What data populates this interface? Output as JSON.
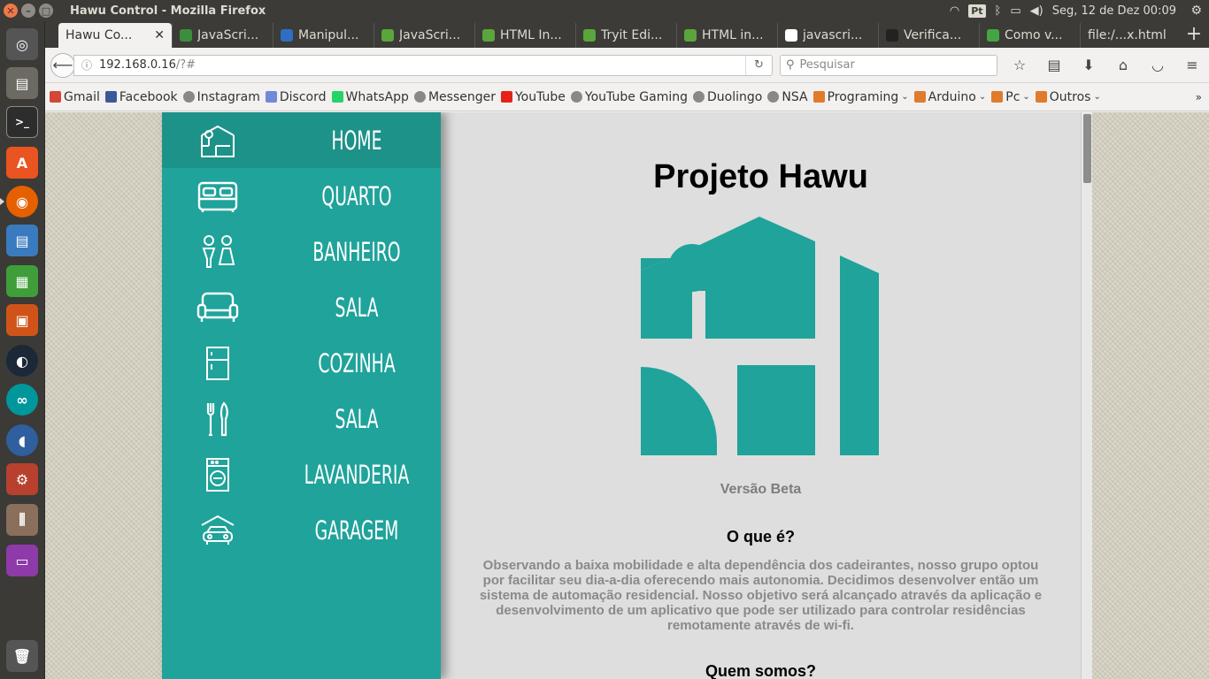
{
  "system_panel": {
    "window_title": "Hawu Control - Mozilla Firefox",
    "keyboard_layout": "Pt",
    "datetime": "Seg, 12 de Dez 00:09"
  },
  "browser": {
    "tabs": [
      {
        "label": "Hawu Co...",
        "active": true,
        "icon_color": ""
      },
      {
        "label": "JavaScri...",
        "active": false,
        "icon_color": "#3b8e3b"
      },
      {
        "label": "Manipul...",
        "active": false,
        "icon_color": "#2f6ec2"
      },
      {
        "label": "JavaScri...",
        "active": false,
        "icon_color": "#5aa53c"
      },
      {
        "label": "HTML In...",
        "active": false,
        "icon_color": "#5aa53c"
      },
      {
        "label": "Tryit Edi...",
        "active": false,
        "icon_color": "#5aa53c"
      },
      {
        "label": "HTML in...",
        "active": false,
        "icon_color": "#5aa53c"
      },
      {
        "label": "javascri...",
        "active": false,
        "icon_color": "#ffffff"
      },
      {
        "label": "Verifica...",
        "active": false,
        "icon_color": "#222222"
      },
      {
        "label": "Como v...",
        "active": false,
        "icon_color": "#45a545"
      },
      {
        "label": "file:/...x.html",
        "active": false,
        "icon_color": ""
      }
    ],
    "url": "192.168.0.16",
    "url_suffix": "/?#",
    "search_placeholder": "Pesquisar",
    "bookmarks": [
      {
        "label": "Gmail",
        "icon_color": "#d44638",
        "folder": false
      },
      {
        "label": "Facebook",
        "icon_color": "#3b5998",
        "folder": false
      },
      {
        "label": "Instagram",
        "icon_color": "#888888",
        "folder": false
      },
      {
        "label": "Discord",
        "icon_color": "#7289da",
        "folder": false
      },
      {
        "label": "WhatsApp",
        "icon_color": "#25d366",
        "folder": false
      },
      {
        "label": "Messenger",
        "icon_color": "#888888",
        "folder": false
      },
      {
        "label": "YouTube",
        "icon_color": "#e62117",
        "folder": false
      },
      {
        "label": "YouTube Gaming",
        "icon_color": "#888888",
        "folder": false
      },
      {
        "label": "Duolingo",
        "icon_color": "#888888",
        "folder": false
      },
      {
        "label": "NSA",
        "icon_color": "#888888",
        "folder": false
      },
      {
        "label": "Programing",
        "icon_color": "#e07b2e",
        "folder": true
      },
      {
        "label": "Arduino",
        "icon_color": "#e07b2e",
        "folder": true
      },
      {
        "label": "Pc",
        "icon_color": "#e07b2e",
        "folder": true
      },
      {
        "label": "Outros",
        "icon_color": "#e07b2e",
        "folder": true
      }
    ]
  },
  "sidebar": {
    "accent": "#1fa39a",
    "items": [
      {
        "label": "HOME",
        "icon": "home-icon",
        "active": true
      },
      {
        "label": "QUARTO",
        "icon": "bed-icon",
        "active": false
      },
      {
        "label": "BANHEIRO",
        "icon": "restroom-icon",
        "active": false
      },
      {
        "label": "SALA",
        "icon": "sofa-icon",
        "active": false
      },
      {
        "label": "COZINHA",
        "icon": "fridge-icon",
        "active": false
      },
      {
        "label": "SALA",
        "icon": "cutlery-icon",
        "active": false
      },
      {
        "label": "LAVANDERIA",
        "icon": "washing-machine-icon",
        "active": false
      },
      {
        "label": "GARAGEM",
        "icon": "car-garage-icon",
        "active": false
      }
    ]
  },
  "main": {
    "title": "Projeto Hawu",
    "version": "Versão Beta",
    "section1_title": "O que é?",
    "section1_text": "Observando a baixa mobilidade e alta dependência dos cadeirantes, nosso grupo optou por facilitar seu dia-a-dia oferecendo mais autonomia. Decidimos desenvolver então um sistema de automação residencial. Nosso objetivo será alcançado através da aplicação e desenvolvimento de um aplicativo que pode ser utilizado para controlar residências remotamente através de wi-fi.",
    "section2_title": "Quem somos?"
  }
}
